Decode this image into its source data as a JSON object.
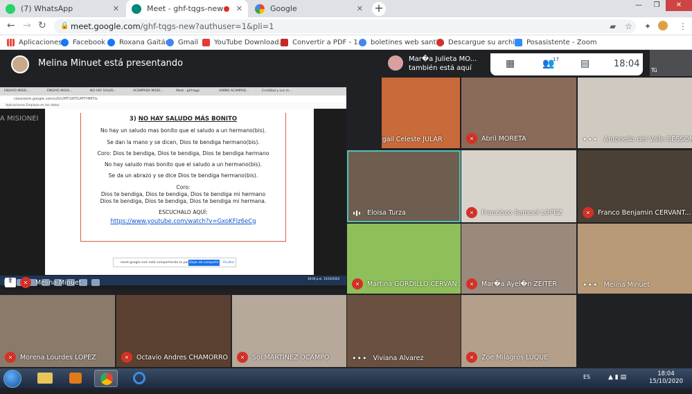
{
  "browser": {
    "tabs": [
      {
        "label": "(7) WhatsApp",
        "icon": "whatsapp-icon",
        "active": false
      },
      {
        "label": "Meet - ghf-tqgs-new",
        "icon": "meet-icon",
        "active": true
      },
      {
        "label": "Google",
        "icon": "google-icon",
        "active": false
      }
    ],
    "new_tab": "+",
    "url_host": "meet.google.com",
    "url_path": "/ghf-tqgs-new?authuser=1&pli=1",
    "bookmarks": [
      {
        "label": "Aplicaciones",
        "icon": "apps-grid-icon",
        "color": "#e8453c"
      },
      {
        "label": "Facebook",
        "icon": "facebook-icon",
        "color": "#1877f2"
      },
      {
        "label": "Roxana Gaitán",
        "icon": "facebook-icon",
        "color": "#1877f2"
      },
      {
        "label": "Gmail",
        "icon": "google-icon",
        "color": "#4285f4"
      },
      {
        "label": "YouTube Download...",
        "icon": "download-icon",
        "color": "#e53935"
      },
      {
        "label": "Convertir a PDF - 1...",
        "icon": "pdf-icon",
        "color": "#c62828"
      },
      {
        "label": "boletines web santi...",
        "icon": "google-icon",
        "color": "#4285f4"
      },
      {
        "label": "Descargue su archi...",
        "icon": "block-icon",
        "color": "#d32f2f"
      },
      {
        "label": "Posasistente - Zoom",
        "icon": "zoom-icon",
        "color": "#2d8cff"
      }
    ]
  },
  "meet": {
    "presenting_text": "Melina Minuet está presentando",
    "also_here_name": "Mar�a Julieta MO...",
    "also_here_text": "también está aquí",
    "participants_count": "17",
    "time": "18:04",
    "self_label": "Tú",
    "shared": {
      "inner_tabs": [
        "ENSAYO MISIO...",
        "ENSAYO MISIO...",
        "NO HAY SALUD...",
        "ACAMPADA MISIO...",
        "Meet - ghf-tqgs",
        "HIMNO ACAMPAD...",
        "Cristóbal y sus m..."
      ],
      "inner_url": "classroom.google.com/u/0/c/MTI1NTI1MTY4MTIx",
      "inner_bookmarks": "Aplicaciones    Empieza en los datos",
      "left_fragment": "A MISIONEI",
      "title_num": "3)",
      "title": "NO HAY SALUDO MÁS BONITO",
      "lines": [
        "No hay un saludo mas bonito que el saludo a un hermano(bis).",
        "Se dan la mano y se dicen, Dios te bendiga hermano(bis).",
        "Coro: Dios te bendiga, Dios te bendiga, Dios te bendiga hermano",
        "No hay saludo mas bonito que el saludo a un hermano(bis).",
        "Se da un abrazo y se dice Dios te bendiga hermano(bis)."
      ],
      "coro_label": "Coro:",
      "coro_lines": [
        "Dios te bendiga, Dios te bendiga, Dios te bendiga mi hermano",
        "Dios te bendiga, Dios te bendiga, Dios te bendiga mi hermana."
      ],
      "listen_label": "ESCUCHALO AQUÍ:",
      "link": "https://www.youtube.com/watch?v=GxoKFIz6eCg",
      "banner_text": "meet.google.com está compartiendo tu pantalla.",
      "banner_stop": "Dejar de compartir",
      "banner_hide": "Ocultar",
      "inner_clock": "18:04 p.m. 15/10/2020"
    },
    "participants": [
      {
        "name": "Melina Minuet",
        "status": "muted",
        "bg": "#3a3a3a"
      },
      {
        "name": "Abigail Celeste JULAR",
        "status": "dots",
        "bg": "#c86a3a"
      },
      {
        "name": "Abril MORETA",
        "status": "muted",
        "bg": "#8a6a58"
      },
      {
        "name": "Antonella del Valle BESSONE",
        "status": "dots",
        "bg": "#cfc9c0"
      },
      {
        "name": "Eloisa Turza",
        "status": "talking",
        "bg": "#6e5e50"
      },
      {
        "name": "Francisco Samuel LOPEZ",
        "status": "muted",
        "bg": "#d7d2ca"
      },
      {
        "name": "Franco Benjamin CERVANT...",
        "status": "muted",
        "bg": "#4a4036"
      },
      {
        "name": "Martina GORDILLO CERVAN...",
        "status": "muted",
        "bg": "#8fbf5a"
      },
      {
        "name": "Mar�a Ayel�n ZEITER",
        "status": "muted",
        "bg": "#9a8a7e"
      },
      {
        "name": "Melina Minuet",
        "status": "dots",
        "bg": "#b89a78"
      },
      {
        "name": "Morena Lourdes LOPEZ",
        "status": "muted",
        "bg": "#8a7a6a"
      },
      {
        "name": "Octavio Andres CHAMORRO",
        "status": "muted",
        "bg": "#5a4030"
      },
      {
        "name": "Sol MARTINEZ OCAMPO",
        "status": "muted",
        "bg": "#b6a89a"
      },
      {
        "name": "Viviana Alvarez",
        "status": "dots",
        "bg": "#6a5040"
      },
      {
        "name": "Zoe Milagros LUQUE",
        "status": "muted",
        "bg": "#b4a08a"
      }
    ]
  },
  "taskbar": {
    "language": "ES",
    "time": "18:04",
    "date": "15/10/2020"
  }
}
